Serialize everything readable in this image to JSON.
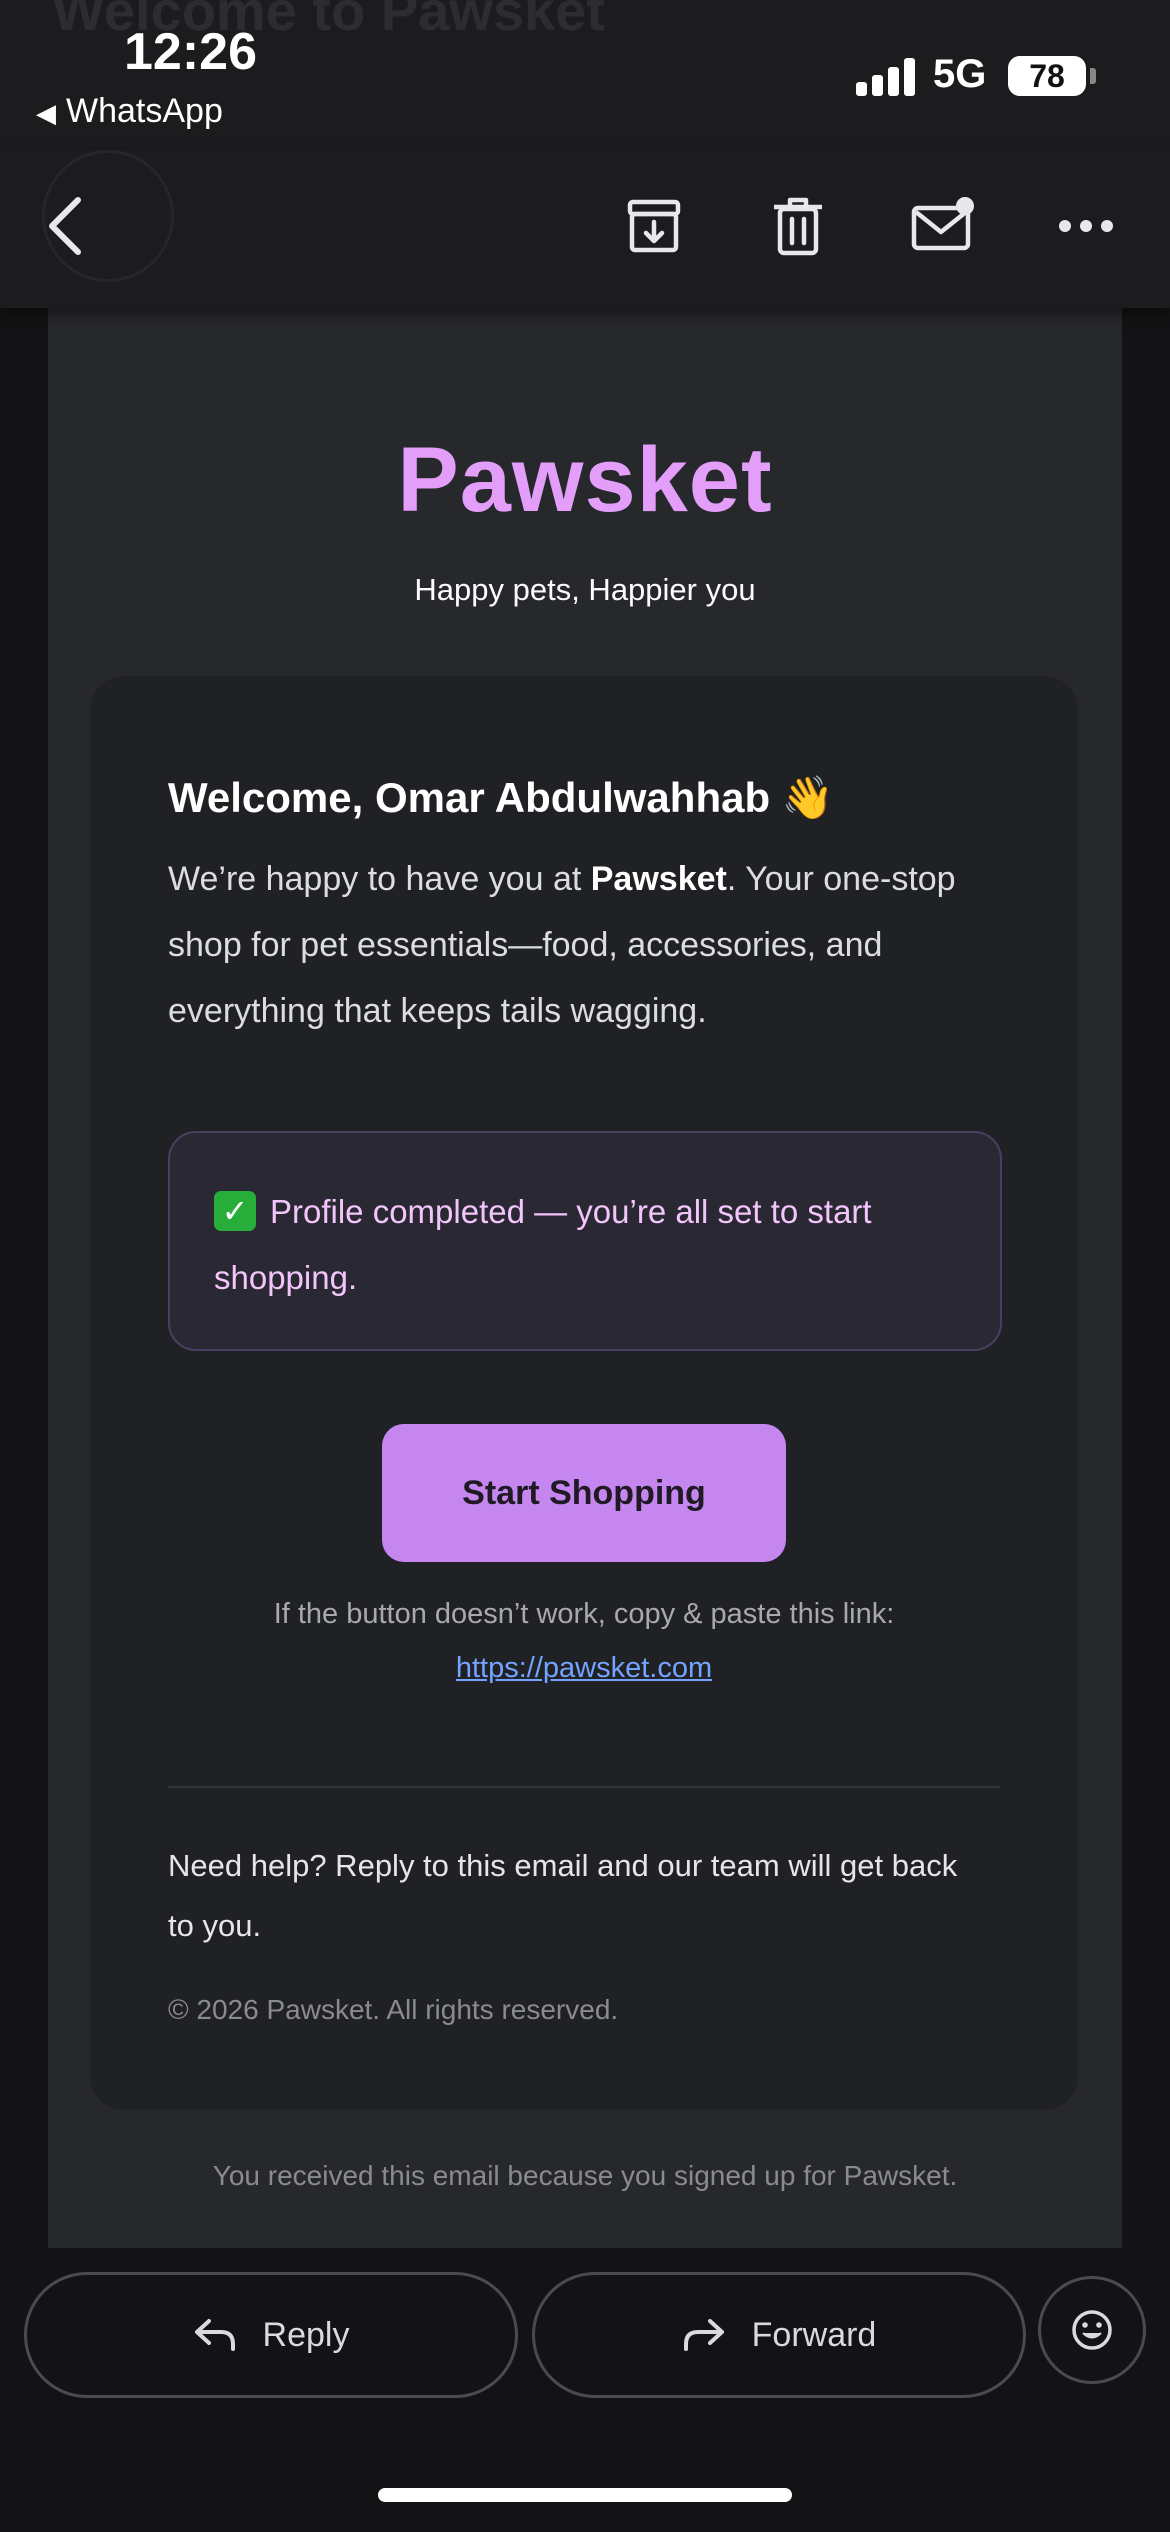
{
  "status_bar": {
    "time": "12:26",
    "back_app": "WhatsApp",
    "network": "5G",
    "battery": "78"
  },
  "header": {
    "ghost_subject": "Welcome to Pawsket",
    "icons": [
      "back-chevron-icon",
      "archive-icon",
      "trash-icon",
      "mark-unread-icon",
      "more-icon"
    ]
  },
  "email": {
    "brand": "Pawsket",
    "tagline": "Happy pets, Happier you",
    "welcome": "Welcome, Omar Abdulwahhab 👋",
    "intro_prefix": "We’re happy to have you at ",
    "intro_brand": "Pawsket",
    "intro_suffix": ". Your one-stop shop for pet essentials—food, accessories, and everything that keeps tails wagging.",
    "notice_check": "✓",
    "notice": "Profile completed — you’re all set to start shopping.",
    "cta_label": "Start Shopping",
    "copy_hint": "If the button doesn’t work, copy & paste this link:",
    "link": "https://pawsket.com",
    "help": "Need help? Reply to this email and our team will get back to you.",
    "copyright": "© 2026 Pawsket. All rights reserved.",
    "footer_note": "You received this email because you signed up for Pawsket."
  },
  "actions": {
    "reply": "Reply",
    "forward": "Forward"
  },
  "colors": {
    "brand": "#e29ef8",
    "cta": "#c586f0",
    "link": "#74a3ff",
    "notice_text": "#f2c5fb"
  }
}
